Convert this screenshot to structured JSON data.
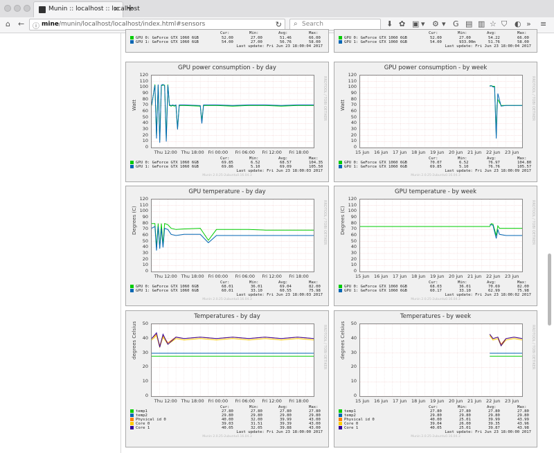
{
  "browser": {
    "tab_title": "Munin :: localhost :: localhost",
    "tab_close": "×",
    "new_tab": "+",
    "url_bold": "mine",
    "url_rest": "/munin/localhost/localhost/index.html#sensors",
    "search_placeholder": "Search"
  },
  "top_partial": {
    "left": {
      "rows": [
        {
          "label": "GPU 0: GeForce GTX 1060 6GB",
          "color": "#00cc00",
          "cur": "52.00",
          "min": "27.00",
          "avg": "51.46",
          "max": "66.00"
        },
        {
          "label": "GPU 1: GeForce GTX 1060 6GB",
          "color": "#0066b3",
          "cur": "54.00",
          "min": "27.00",
          "avg": "56.76",
          "max": "58.00"
        }
      ],
      "last_update": "Last update: Fri Jun 23 18:00:04 2017"
    },
    "right": {
      "rows": [
        {
          "label": "GPU 0: GeForce GTX 1060 6GB",
          "color": "#00cc00",
          "cur": "52.00",
          "min": "27.00",
          "avg": "54.22",
          "max": "66.00"
        },
        {
          "label": "GPU 1: GeForce GTX 1060 6GB",
          "color": "#0066b3",
          "cur": "54.00",
          "min": "933.00m",
          "avg": "51.76",
          "max": "58.00"
        }
      ],
      "last_update": "Last update: Fri Jun 23 18:00:04 2017"
    }
  },
  "legend_headers": {
    "cur": "Cur:",
    "min": "Min:",
    "avg": "Avg:",
    "max": "Max:"
  },
  "footer": "Munin 2.0.25-2ubuntu0.16.04.3",
  "chart_data": [
    {
      "id": "power-day",
      "type": "line",
      "title": "GPU power consumption - by day",
      "ylabel": "Watt",
      "ylim": [
        0,
        120
      ],
      "yticks": [
        "120",
        "110",
        "100",
        "90",
        "80",
        "70",
        "60",
        "50",
        "40",
        "30",
        "20",
        "10",
        "0"
      ],
      "xticks": [
        "Thu 12:00",
        "Thu 18:00",
        "Fri 00:00",
        "Fri 06:00",
        "Fri 12:00",
        "Fri 18:00"
      ],
      "grid": true,
      "series": [
        {
          "name": "GPU 0: GeForce GTX 1060 6GB",
          "color": "#00cc00",
          "x": [
            0,
            0.02,
            0.03,
            0.04,
            0.05,
            0.06,
            0.07,
            0.08,
            0.09,
            0.1,
            0.11,
            0.12,
            0.13,
            0.14,
            0.15,
            0.16,
            0.17,
            0.2,
            0.3,
            0.31,
            0.32,
            0.4,
            0.5,
            0.6,
            0.7,
            0.8,
            0.9,
            1
          ],
          "y": [
            70,
            105,
            20,
            104,
            12,
            103,
            104,
            104,
            15,
            105,
            70,
            69,
            70,
            69,
            70,
            32,
            70,
            70,
            69,
            45,
            70,
            70,
            69,
            70,
            70,
            69,
            70,
            70
          ]
        },
        {
          "name": "GPU 1: GeForce GTX 1060 6GB",
          "color": "#0066b3",
          "x": [
            0,
            0.02,
            0.03,
            0.04,
            0.05,
            0.06,
            0.07,
            0.08,
            0.09,
            0.1,
            0.11,
            0.12,
            0.13,
            0.14,
            0.15,
            0.16,
            0.17,
            0.2,
            0.3,
            0.31,
            0.32,
            0.4,
            0.5,
            0.6,
            0.7,
            0.8,
            0.9,
            1
          ],
          "y": [
            71,
            104,
            15,
            105,
            8,
            104,
            105,
            103,
            10,
            104,
            71,
            70,
            71,
            70,
            71,
            30,
            71,
            71,
            70,
            40,
            71,
            71,
            70,
            71,
            71,
            70,
            71,
            71
          ]
        }
      ],
      "legend": [
        {
          "label": "GPU 0: GeForce GTX 1060 6GB",
          "color": "#00cc00",
          "cur": "69.85",
          "min": "6.52",
          "avg": "68.57",
          "max": "104.35"
        },
        {
          "label": "GPU 1: GeForce GTX 1060 6GB",
          "color": "#0066b3",
          "cur": "69.86",
          "min": "5.10",
          "avg": "69.09",
          "max": "105.50"
        }
      ],
      "last_update": "Last update: Fri Jun 23 18:00:03 2017"
    },
    {
      "id": "power-week",
      "type": "line",
      "title": "GPU power consumption - by week",
      "ylabel": "Watt",
      "ylim": [
        0,
        120
      ],
      "yticks": [
        "120",
        "110",
        "100",
        "90",
        "80",
        "70",
        "60",
        "50",
        "40",
        "30",
        "20",
        "10",
        "0"
      ],
      "xticks": [
        "15 jun",
        "16 jun",
        "17 jun",
        "18 jun",
        "19 jun",
        "20 jun",
        "21 jun",
        "22 jun",
        "23 jun"
      ],
      "grid": true,
      "series": [
        {
          "name": "GPU 0: GeForce GTX 1060 6GB",
          "color": "#00cc00",
          "x": [
            0.8,
            0.81,
            0.82,
            0.83,
            0.84,
            0.845,
            0.85,
            0.87,
            0.9,
            1
          ],
          "y": [
            103,
            103,
            102,
            102,
            20,
            70,
            80,
            70,
            70,
            70
          ]
        },
        {
          "name": "GPU 1: GeForce GTX 1060 6GB",
          "color": "#0066b3",
          "x": [
            0.8,
            0.81,
            0.82,
            0.83,
            0.84,
            0.845,
            0.85,
            0.87,
            0.9,
            1
          ],
          "y": [
            102,
            103,
            101,
            101,
            15,
            62,
            90,
            69,
            70,
            70
          ]
        }
      ],
      "legend": [
        {
          "label": "GPU 0: GeForce GTX 1060 6GB",
          "color": "#00cc00",
          "cur": "70.07",
          "min": "6.52",
          "avg": "76.97",
          "max": "104.80"
        },
        {
          "label": "GPU 1: GeForce GTX 1060 6GB",
          "color": "#0066b3",
          "cur": "69.85",
          "min": "5.10",
          "avg": "76.76",
          "max": "105.57"
        }
      ],
      "last_update": "Last update: Fri Jun 23 18:00:09 2017"
    },
    {
      "id": "temp-day",
      "type": "line",
      "title": "GPU temperature - by day",
      "ylabel": "Degrees (C)",
      "ylim": [
        0,
        120
      ],
      "yticks": [
        "120",
        "110",
        "100",
        "90",
        "80",
        "70",
        "60",
        "50",
        "40",
        "30",
        "20",
        "10",
        "0"
      ],
      "xticks": [
        "Thu 12:00",
        "Thu 18:00",
        "Fri 00:00",
        "Fri 06:00",
        "Fri 12:00",
        "Fri 18:00"
      ],
      "grid": true,
      "series": [
        {
          "name": "GPU 0: GeForce GTX 1060 6GB",
          "color": "#00cc00",
          "x": [
            0,
            0.02,
            0.03,
            0.04,
            0.05,
            0.06,
            0.07,
            0.08,
            0.1,
            0.12,
            0.15,
            0.2,
            0.3,
            0.35,
            0.4,
            0.5,
            0.6,
            0.7,
            0.8,
            0.9,
            1
          ],
          "y": [
            80,
            80,
            40,
            80,
            40,
            80,
            45,
            80,
            78,
            72,
            70,
            71,
            72,
            52,
            70,
            70,
            70,
            69,
            69,
            69,
            69
          ]
        },
        {
          "name": "GPU 1: GeForce GTX 1060 6GB",
          "color": "#0066b3",
          "x": [
            0,
            0.02,
            0.03,
            0.04,
            0.05,
            0.06,
            0.07,
            0.08,
            0.1,
            0.12,
            0.15,
            0.2,
            0.3,
            0.35,
            0.4,
            0.5,
            0.6,
            0.7,
            0.8,
            0.9,
            1
          ],
          "y": [
            72,
            75,
            35,
            75,
            38,
            72,
            40,
            72,
            70,
            62,
            60,
            62,
            62,
            48,
            60,
            60,
            60,
            60,
            60,
            60,
            60
          ]
        }
      ],
      "legend": [
        {
          "label": "GPU 0: GeForce GTX 1060 6GB",
          "color": "#00cc00",
          "cur": "68.01",
          "min": "36.01",
          "avg": "69.04",
          "max": "82.00"
        },
        {
          "label": "GPU 1: GeForce GTX 1060 6GB",
          "color": "#0066b3",
          "cur": "60.01",
          "min": "33.10",
          "avg": "60.55",
          "max": "75.98"
        }
      ],
      "last_update": "Last update: Fri Jun 23 18:00:03 2017"
    },
    {
      "id": "temp-week",
      "type": "line",
      "title": "GPU temperature - by week",
      "ylabel": "Degrees (C)",
      "ylim": [
        0,
        120
      ],
      "yticks": [
        "120",
        "110",
        "100",
        "90",
        "80",
        "70",
        "60",
        "50",
        "40",
        "30",
        "20",
        "10",
        "0"
      ],
      "xticks": [
        "15 jun",
        "16 jun",
        "17 jun",
        "18 jun",
        "19 jun",
        "20 jun",
        "21 jun",
        "22 jun",
        "23 jun"
      ],
      "grid": true,
      "series": [
        {
          "name": "GPU 0: GeForce GTX 1060 6GB",
          "color": "#00cc00",
          "x": [
            0,
            0.8,
            0.81,
            0.82,
            0.84,
            0.85,
            0.86,
            0.9,
            1
          ],
          "y": [
            75,
            75,
            80,
            79,
            60,
            76,
            72,
            72,
            72
          ]
        },
        {
          "name": "GPU 1: GeForce GTX 1060 6GB",
          "color": "#0066b3",
          "x": [
            0.8,
            0.81,
            0.82,
            0.84,
            0.85,
            0.86,
            0.9,
            1
          ],
          "y": [
            78,
            78,
            77,
            55,
            70,
            62,
            60,
            60
          ]
        }
      ],
      "legend": [
        {
          "label": "GPU 0: GeForce GTX 1060 6GB",
          "color": "#00cc00",
          "cur": "68.03",
          "min": "36.01",
          "avg": "70.69",
          "max": "82.00"
        },
        {
          "label": "GPU 1: GeForce GTX 1060 6GB",
          "color": "#0066b3",
          "cur": "60.17",
          "min": "33.10",
          "avg": "62.99",
          "max": "75.98"
        }
      ],
      "last_update": "Last update: Fri Jun 23 18:00:02 2017"
    },
    {
      "id": "cpu-day",
      "type": "line",
      "title": "Temperatures - by day",
      "ylabel": "degrees Celsius",
      "ylim": [
        0,
        50
      ],
      "yticks": [
        "50",
        "40",
        "30",
        "20",
        "10",
        "0"
      ],
      "xticks": [
        "Thu 12:00",
        "Thu 18:00",
        "Fri 00:00",
        "Fri 06:00",
        "Fri 12:00",
        "Fri 18:00"
      ],
      "grid": true,
      "series": [
        {
          "name": "temp1",
          "color": "#00cc00",
          "x": [
            0,
            1
          ],
          "y": [
            27.8,
            27.8
          ]
        },
        {
          "name": "temp2",
          "color": "#0066b3",
          "x": [
            0,
            1
          ],
          "y": [
            29.8,
            29.8
          ]
        },
        {
          "name": "Physical id 0",
          "color": "#ff8000",
          "x": [
            0,
            0.03,
            0.05,
            0.07,
            0.1,
            0.15,
            0.2,
            0.3,
            0.4,
            0.5,
            0.6,
            0.7,
            0.8,
            0.9,
            1
          ],
          "y": [
            40,
            43,
            35,
            42,
            37,
            41,
            40,
            41,
            40,
            41,
            40,
            41,
            40,
            41,
            40
          ]
        },
        {
          "name": "Core 0",
          "color": "#ffcc00",
          "x": [
            0,
            0.03,
            0.05,
            0.07,
            0.1,
            0.15,
            0.2,
            0.3,
            0.4,
            0.5,
            0.6,
            0.7,
            0.8,
            0.9,
            1
          ],
          "y": [
            39,
            42,
            34,
            41,
            36,
            40,
            39,
            40,
            39,
            40,
            39,
            40,
            39,
            40,
            39
          ]
        },
        {
          "name": "Core 1",
          "color": "#330099",
          "x": [
            0,
            0.03,
            0.05,
            0.07,
            0.1,
            0.15,
            0.2,
            0.3,
            0.4,
            0.5,
            0.6,
            0.7,
            0.8,
            0.9,
            1
          ],
          "y": [
            40,
            44,
            34,
            43,
            36,
            41,
            40,
            41,
            40,
            41,
            40,
            41,
            40,
            41,
            40
          ]
        }
      ],
      "legend": [
        {
          "label": "temp1",
          "color": "#00cc00",
          "cur": "27.80",
          "min": "27.80",
          "avg": "27.80",
          "max": "27.80"
        },
        {
          "label": "temp2",
          "color": "#0066b3",
          "cur": "29.80",
          "min": "29.80",
          "avg": "29.80",
          "max": "29.80"
        },
        {
          "label": "Physical id 0",
          "color": "#ff8000",
          "cur": "40.00",
          "min": "32.00",
          "avg": "39.99",
          "max": "43.00"
        },
        {
          "label": "Core 0",
          "color": "#ffcc00",
          "cur": "39.03",
          "min": "31.51",
          "avg": "39.39",
          "max": "43.00"
        },
        {
          "label": "Core 1",
          "color": "#330099",
          "cur": "40.05",
          "min": "32.05",
          "avg": "39.88",
          "max": "43.00"
        }
      ],
      "last_update": "Last update: Fri Jun 23 18:00:00 2017"
    },
    {
      "id": "cpu-week",
      "type": "line",
      "title": "Temperatures - by week",
      "ylabel": "degrees Celsius",
      "ylim": [
        0,
        50
      ],
      "yticks": [
        "50",
        "40",
        "30",
        "20",
        "10",
        "0"
      ],
      "xticks": [
        "15 jun",
        "16 jun",
        "17 jun",
        "18 jun",
        "19 jun",
        "20 jun",
        "21 jun",
        "22 jun",
        "23 jun"
      ],
      "grid": true,
      "series": [
        {
          "name": "temp1",
          "color": "#00cc00",
          "x": [
            0.8,
            1
          ],
          "y": [
            27.8,
            27.8
          ]
        },
        {
          "name": "temp2",
          "color": "#0066b3",
          "x": [
            0.8,
            1
          ],
          "y": [
            29.8,
            29.8
          ]
        },
        {
          "name": "Physical id 0",
          "color": "#ff8000",
          "x": [
            0.8,
            0.82,
            0.85,
            0.87,
            0.9,
            0.95,
            1
          ],
          "y": [
            43,
            40,
            41,
            36,
            40,
            41,
            40
          ]
        },
        {
          "name": "Core 0",
          "color": "#ffcc00",
          "x": [
            0.8,
            0.82,
            0.85,
            0.87,
            0.9,
            0.95,
            1
          ],
          "y": [
            42,
            39,
            40,
            35,
            39,
            40,
            39
          ]
        },
        {
          "name": "Core 1",
          "color": "#330099",
          "x": [
            0.8,
            0.82,
            0.85,
            0.87,
            0.9,
            0.95,
            1
          ],
          "y": [
            43,
            40,
            41,
            35,
            40,
            41,
            40
          ]
        }
      ],
      "legend": [
        {
          "label": "temp1",
          "color": "#00cc00",
          "cur": "27.80",
          "min": "27.80",
          "avg": "27.80",
          "max": "27.80"
        },
        {
          "label": "temp2",
          "color": "#0066b3",
          "cur": "29.80",
          "min": "29.80",
          "avg": "29.80",
          "max": "29.80"
        },
        {
          "label": "Physical id 0",
          "color": "#ff8000",
          "cur": "40.00",
          "min": "25.01",
          "avg": "39.99",
          "max": "43.99"
        },
        {
          "label": "Core 0",
          "color": "#ffcc00",
          "cur": "39.04",
          "min": "26.00",
          "avg": "39.35",
          "max": "43.96"
        },
        {
          "label": "Core 1",
          "color": "#330099",
          "cur": "40.05",
          "min": "25.01",
          "avg": "39.87",
          "max": "43.98"
        }
      ],
      "last_update": "Last update: Fri Jun 23 18:00:00 2017"
    }
  ]
}
